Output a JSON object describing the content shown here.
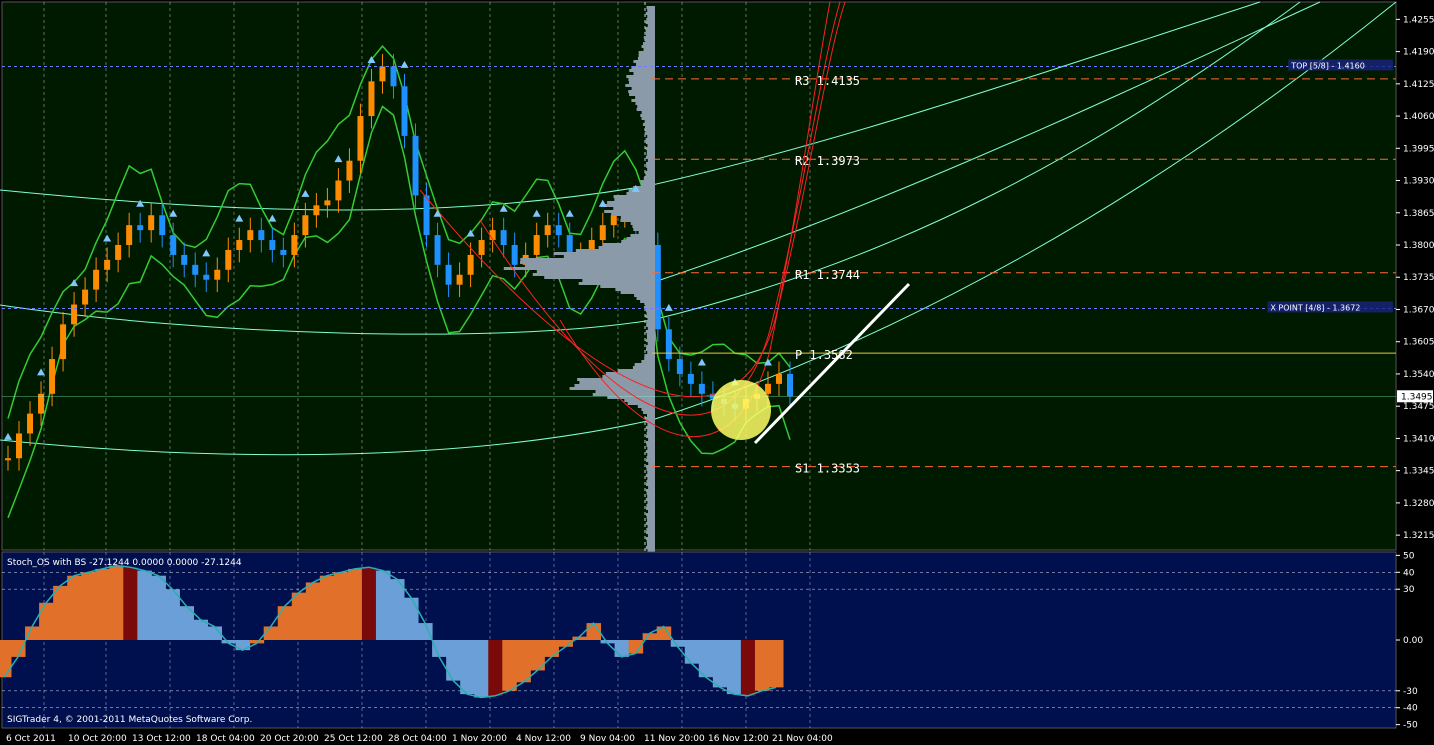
{
  "colors": {
    "main_bg": "#001a00",
    "sub_bg": "#000f4d",
    "grid": "#ffffff",
    "bull": "#ff8c00",
    "bear": "#1e90ff",
    "bb": "#33cc33",
    "arc": "#7fffd4",
    "pivot": "#ff6a33",
    "profile": "#8a9aa8",
    "red_ch": "#ff2020",
    "pivot_p": "#e6cc33",
    "stoch_orange": "#e0702a",
    "stoch_blue": "#6a9fd8",
    "stoch_red": "#7a0a0a",
    "stoch_line": "#2ab0b0",
    "white_line": "#ffffff",
    "highlight": "#ffff66"
  },
  "chart_data": [
    {
      "type": "candlestick",
      "title": "",
      "ylim": [
        1.3185,
        1.429
      ],
      "y_ticks": [
        "1.4255",
        "1.4190",
        "1.4125",
        "1.4060",
        "1.3995",
        "1.3930",
        "1.3865",
        "1.3800",
        "1.3735",
        "1.3670",
        "1.3605",
        "1.3540",
        "1.3475",
        "1.3410",
        "1.3345",
        "1.3280",
        "1.3215"
      ],
      "current_price": "1.3495",
      "x_ticks": [
        "6 Oct 2011",
        "10 Oct 20:00",
        "13 Oct 12:00",
        "18 Oct 04:00",
        "20 Oct 20:00",
        "25 Oct 12:00",
        "28 Oct 04:00",
        "1 Nov 20:00",
        "4 Nov 12:00",
        "9 Nov 04:00",
        "11 Nov 20:00",
        "16 Nov 12:00",
        "21 Nov 04:00"
      ],
      "pivots": [
        {
          "label": "R3",
          "value": "1.4135",
          "price": 1.4135
        },
        {
          "label": "R2",
          "value": "1.3973",
          "price": 1.3973
        },
        {
          "label": "R1",
          "value": "1.3744",
          "price": 1.3744
        },
        {
          "label": "P",
          "value": "1.3582",
          "price": 1.3582
        },
        {
          "label": "S1",
          "value": "1.3353",
          "price": 1.3353
        }
      ],
      "murrey": [
        {
          "label": "TOP  [5/8] - 1.4160",
          "price": 1.416
        },
        {
          "label": "X POINT  [4/8] - 1.3672",
          "price": 1.3672
        }
      ],
      "close_series": [
        1.337,
        1.342,
        1.346,
        1.35,
        1.357,
        1.364,
        1.368,
        1.371,
        1.375,
        1.377,
        1.38,
        1.384,
        1.383,
        1.386,
        1.382,
        1.378,
        1.376,
        1.374,
        1.373,
        1.375,
        1.379,
        1.381,
        1.383,
        1.381,
        1.379,
        1.378,
        1.382,
        1.386,
        1.388,
        1.389,
        1.393,
        1.397,
        1.406,
        1.413,
        1.416,
        1.412,
        1.402,
        1.39,
        1.382,
        1.376,
        1.372,
        1.374,
        1.378,
        1.381,
        1.383,
        1.38,
        1.376,
        1.378,
        1.382,
        1.384,
        1.382,
        1.378,
        1.378,
        1.381,
        1.384,
        1.386,
        1.387,
        1.384,
        1.38,
        1.363,
        1.357,
        1.354,
        1.352,
        1.35,
        1.349,
        1.348,
        1.347,
        1.349,
        1.35,
        1.352,
        1.354,
        1.3495
      ]
    },
    {
      "type": "bar",
      "title": "Stoch_OS with BS -27.1244 0.0000 0.0000 -27.1244",
      "ylim": [
        -52,
        52
      ],
      "y_ticks": [
        "50",
        "40",
        "30",
        "0.00",
        "-30",
        "-40",
        "-50"
      ],
      "values": [
        -22,
        -10,
        8,
        22,
        32,
        38,
        40,
        42,
        44,
        43,
        41,
        38,
        30,
        20,
        12,
        8,
        -2,
        -6,
        -2,
        8,
        20,
        28,
        34,
        38,
        40,
        42,
        43,
        41,
        36,
        25,
        10,
        -10,
        -24,
        -32,
        -34,
        -33,
        -30,
        -25,
        -18,
        -10,
        -4,
        2,
        10,
        -2,
        -10,
        -8,
        4,
        8,
        -4,
        -14,
        -22,
        -28,
        -32,
        -33,
        -30,
        -28
      ]
    }
  ],
  "footer_text": "SIGTrader 4, © 2001-2011 MetaQuotes Software Corp."
}
